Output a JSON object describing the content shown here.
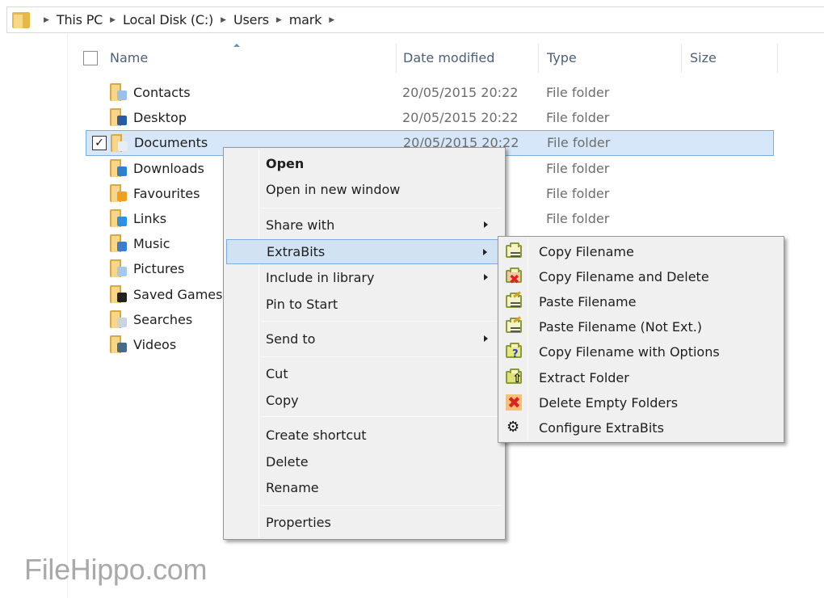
{
  "breadcrumb": [
    "This PC",
    "Local Disk (C:)",
    "Users",
    "mark"
  ],
  "columns": {
    "name": "Name",
    "date_modified": "Date modified",
    "type": "Type",
    "size": "Size"
  },
  "files": [
    {
      "name": "Contacts",
      "date": "20/05/2015 20:22",
      "type": "File folder",
      "icon": "contacts-folder-icon",
      "selected": false
    },
    {
      "name": "Desktop",
      "date": "20/05/2015 20:22",
      "type": "File folder",
      "icon": "desktop-folder-icon",
      "selected": false
    },
    {
      "name": "Documents",
      "date": "20/05/2015 20:22",
      "type": "File folder",
      "icon": "documents-folder-icon",
      "selected": true
    },
    {
      "name": "Downloads",
      "date": "",
      "type": "File folder",
      "icon": "downloads-folder-icon",
      "selected": false
    },
    {
      "name": "Favourites",
      "date": "",
      "type": "File folder",
      "icon": "favourites-folder-icon",
      "selected": false
    },
    {
      "name": "Links",
      "date": "",
      "type": "File folder",
      "icon": "links-folder-icon",
      "selected": false
    },
    {
      "name": "Music",
      "date": "",
      "type": "",
      "icon": "music-folder-icon",
      "selected": false
    },
    {
      "name": "Pictures",
      "date": "",
      "type": "",
      "icon": "pictures-folder-icon",
      "selected": false
    },
    {
      "name": "Saved Games",
      "date": "",
      "type": "",
      "icon": "saved-games-folder-icon",
      "selected": false
    },
    {
      "name": "Searches",
      "date": "",
      "type": "",
      "icon": "searches-folder-icon",
      "selected": false
    },
    {
      "name": "Videos",
      "date": "",
      "type": "",
      "icon": "videos-folder-icon",
      "selected": false
    }
  ],
  "context_menu": {
    "items": [
      {
        "label": "Open",
        "bold": true
      },
      {
        "label": "Open in new window"
      },
      {
        "label": "Share with",
        "submenu": true
      },
      {
        "label": "ExtraBits",
        "submenu": true,
        "highlighted": true
      },
      {
        "label": "Include in library",
        "submenu": true
      },
      {
        "label": "Pin to Start"
      },
      {
        "label": "Send to",
        "submenu": true
      },
      {
        "label": "Cut"
      },
      {
        "label": "Copy"
      },
      {
        "label": "Create shortcut"
      },
      {
        "label": "Delete"
      },
      {
        "label": "Rename"
      },
      {
        "label": "Properties"
      }
    ]
  },
  "extrabits_menu": {
    "items": [
      {
        "label": "Copy Filename",
        "icon": "copy-filename-icon"
      },
      {
        "label": "Copy Filename and Delete",
        "icon": "copy-filename-delete-icon"
      },
      {
        "label": "Paste Filename",
        "icon": "paste-filename-icon"
      },
      {
        "label": "Paste Filename (Not Ext.)",
        "icon": "paste-filename-noext-icon"
      },
      {
        "label": "Copy Filename with Options",
        "icon": "copy-filename-options-icon"
      },
      {
        "label": "Extract Folder",
        "icon": "extract-folder-icon"
      },
      {
        "label": "Delete Empty Folders",
        "icon": "delete-empty-folders-icon"
      },
      {
        "label": "Configure ExtraBits",
        "icon": "gear-icon"
      }
    ]
  },
  "watermark": "FileHippo.com",
  "colors": {
    "selection_bg": "#d5e7f8",
    "selection_border": "#7ab0e0",
    "menu_bg": "#f0f0f0",
    "header_text": "#4c607a"
  }
}
